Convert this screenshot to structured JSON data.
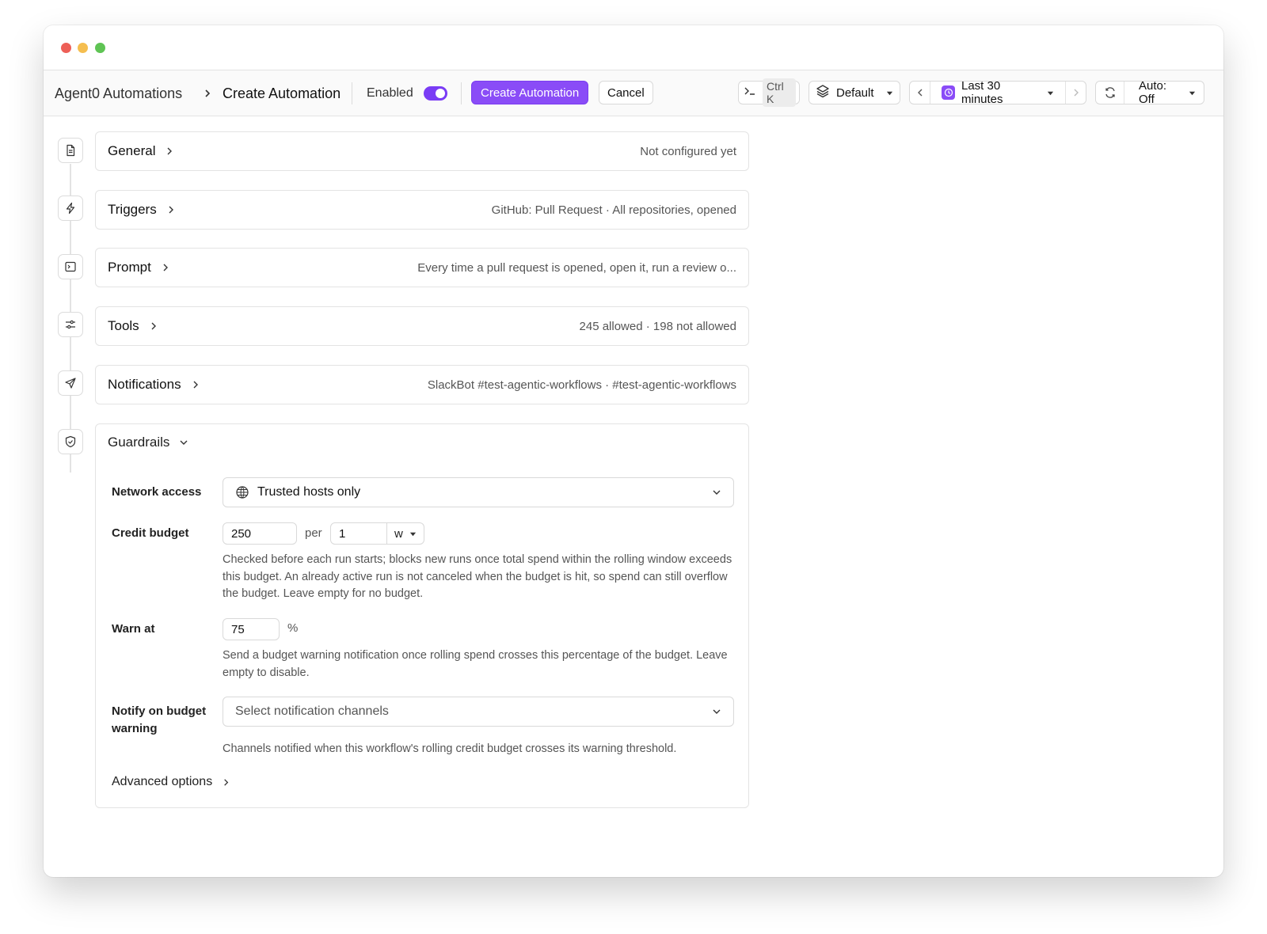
{
  "breadcrumb": {
    "root": "Agent0 Automations",
    "current": "Create Automation"
  },
  "toolbar": {
    "enabled_label": "Enabled",
    "enabled": true,
    "create_label": "Create Automation",
    "cancel_label": "Cancel",
    "command_shortcut": "Ctrl K",
    "workspace": "Default",
    "time_range": "Last 30 minutes",
    "auto_refresh": "Auto: Off"
  },
  "colors": {
    "accent": "#8a4cf7",
    "toggle": "#7a3cf5"
  },
  "sections": [
    {
      "title": "General",
      "summary": "Not configured yet",
      "icon": "document-icon"
    },
    {
      "title": "Triggers",
      "summary": "GitHub: Pull Request · All repositories, opened",
      "icon": "lightning-icon"
    },
    {
      "title": "Prompt",
      "summary": "Every time a pull request is opened, open it, run a review o...",
      "icon": "terminal-icon"
    },
    {
      "title": "Tools",
      "summary": "245 allowed · 198 not allowed",
      "icon": "sliders-icon"
    },
    {
      "title": "Notifications",
      "summary": "SlackBot #test-agentic-workflows · #test-agentic-workflows",
      "icon": "send-icon"
    }
  ],
  "guardrails": {
    "title": "Guardrails",
    "icon": "shield-icon",
    "network_access": {
      "label": "Network access",
      "value": "Trusted hosts only"
    },
    "credit_budget": {
      "label": "Credit budget",
      "amount": "250",
      "per_label": "per",
      "period": "1",
      "unit": "w",
      "help": "Checked before each run starts; blocks new runs once total spend within the rolling window exceeds this budget. An already active run is not canceled when the budget is hit, so spend can still overflow the budget. Leave empty for no budget."
    },
    "warn_at": {
      "label": "Warn at",
      "value": "75",
      "unit": "%",
      "help": "Send a budget warning notification once rolling spend crosses this percentage of the budget. Leave empty to disable."
    },
    "notify": {
      "label": "Notify on budget warning",
      "placeholder": "Select notification channels",
      "help": "Channels notified when this workflow's rolling credit budget crosses its warning threshold."
    },
    "advanced_label": "Advanced options"
  }
}
